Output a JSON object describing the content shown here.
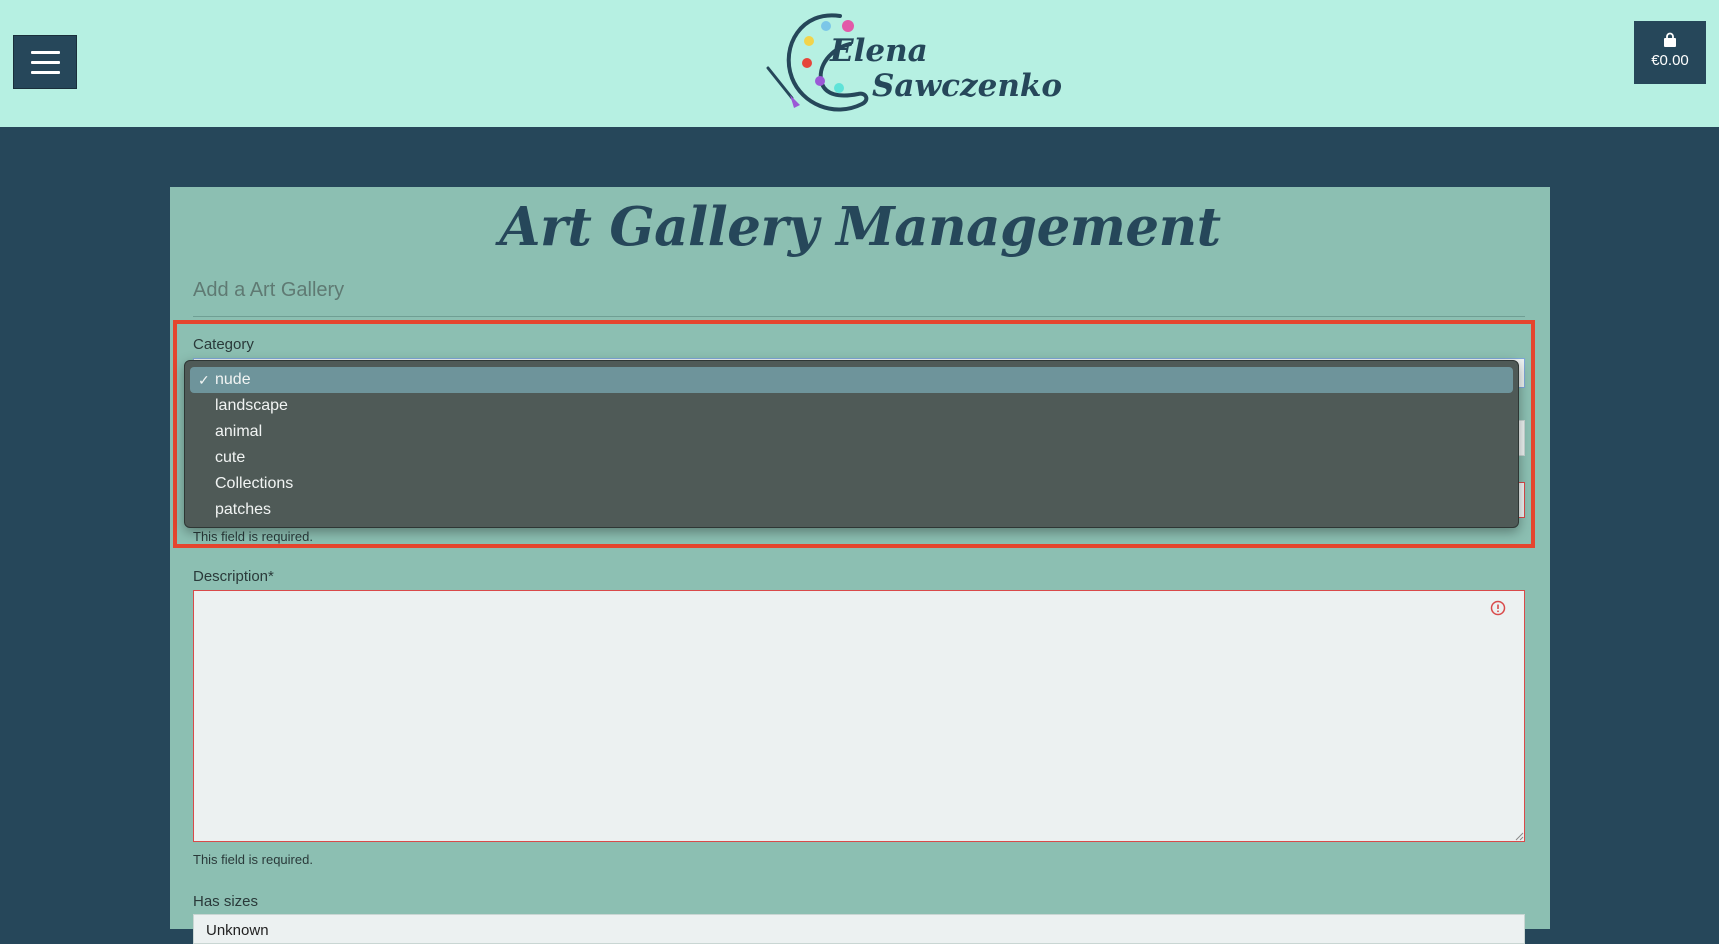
{
  "header": {
    "brand_line1": "Elena",
    "brand_line2": "Sawczenko",
    "cart_total": "€0.00"
  },
  "page": {
    "title": "Art Gallery Management",
    "subtitle": "Add a Art Gallery"
  },
  "form": {
    "category_label": "Category",
    "category_options": [
      "nude",
      "landscape",
      "animal",
      "cute",
      "Collections",
      "patches"
    ],
    "category_selected": "nude",
    "check_mark": "✓",
    "required_help": "This field is required.",
    "description_label": "Description*",
    "description_help": "This field is required.",
    "has_sizes_label": "Has sizes",
    "has_sizes_value": "Unknown"
  },
  "colors": {
    "header_bg": "#b6f0e2",
    "page_bg": "#26475a",
    "panel_bg": "#8cbfb2",
    "highlight": "#e5452e",
    "error": "#d94a4a"
  }
}
